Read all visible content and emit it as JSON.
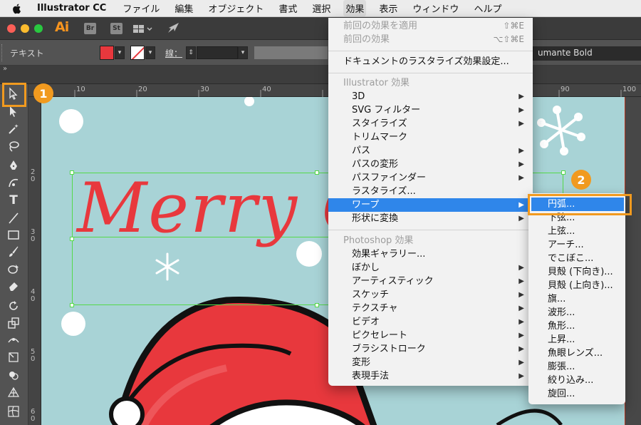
{
  "menubar": {
    "app_name": "Illustrator CC",
    "items": [
      "ファイル",
      "編集",
      "オブジェクト",
      "書式",
      "選択",
      "効果",
      "表示",
      "ウィンドウ",
      "ヘルプ"
    ]
  },
  "appbar": {
    "logo": "Ai",
    "bridge": "Br",
    "stock": "St"
  },
  "controlbar": {
    "selection_label": "テキスト",
    "stroke_label": "線：",
    "font_name": "umante Bold",
    "fill_color": "#e8383d"
  },
  "ruler": {
    "h_ticks": [
      "10",
      "20",
      "30",
      "40",
      "90",
      "100"
    ],
    "v_ticks": [
      "2",
      "0",
      "3",
      "0",
      "4",
      "0",
      "5",
      "0",
      "6",
      "0"
    ]
  },
  "canvas": {
    "artwork_text": "Merry C",
    "bg_color": "#a8d3d6",
    "text_color": "#e8383d"
  },
  "badges": {
    "one": "1",
    "two": "2"
  },
  "effect_menu": {
    "apply_last": {
      "label": "前回の効果を適用",
      "shortcut": "⇧⌘E"
    },
    "last_effect": {
      "label": "前回の効果",
      "shortcut": "⌥⇧⌘E"
    },
    "rasterize_settings": "ドキュメントのラスタライズ効果設定...",
    "illustrator_header": "Illustrator 効果",
    "illustrator_items": [
      "3D",
      "SVG フィルター",
      "スタイライズ",
      "トリムマーク",
      "パス",
      "パスの変形",
      "パスファインダー",
      "ラスタライズ...",
      "ワープ",
      "形状に変換"
    ],
    "photoshop_header": "Photoshop 効果",
    "photoshop_items": [
      "効果ギャラリー...",
      "ぼかし",
      "アーティスティック",
      "スケッチ",
      "テクスチャ",
      "ビデオ",
      "ピクセレート",
      "ブラシストローク",
      "変形",
      "表現手法"
    ]
  },
  "warp_submenu": {
    "items": [
      "円弧...",
      "下弦...",
      "上弦...",
      "アーチ...",
      "でこぼこ...",
      "貝殻 (下向き)...",
      "貝殻 (上向き)...",
      "旗...",
      "波形...",
      "魚形...",
      "上昇...",
      "魚眼レンズ...",
      "膨張...",
      "絞り込み...",
      "旋回..."
    ]
  },
  "colors": {
    "highlight": "#2f86ea",
    "badge": "#f19a1f"
  }
}
